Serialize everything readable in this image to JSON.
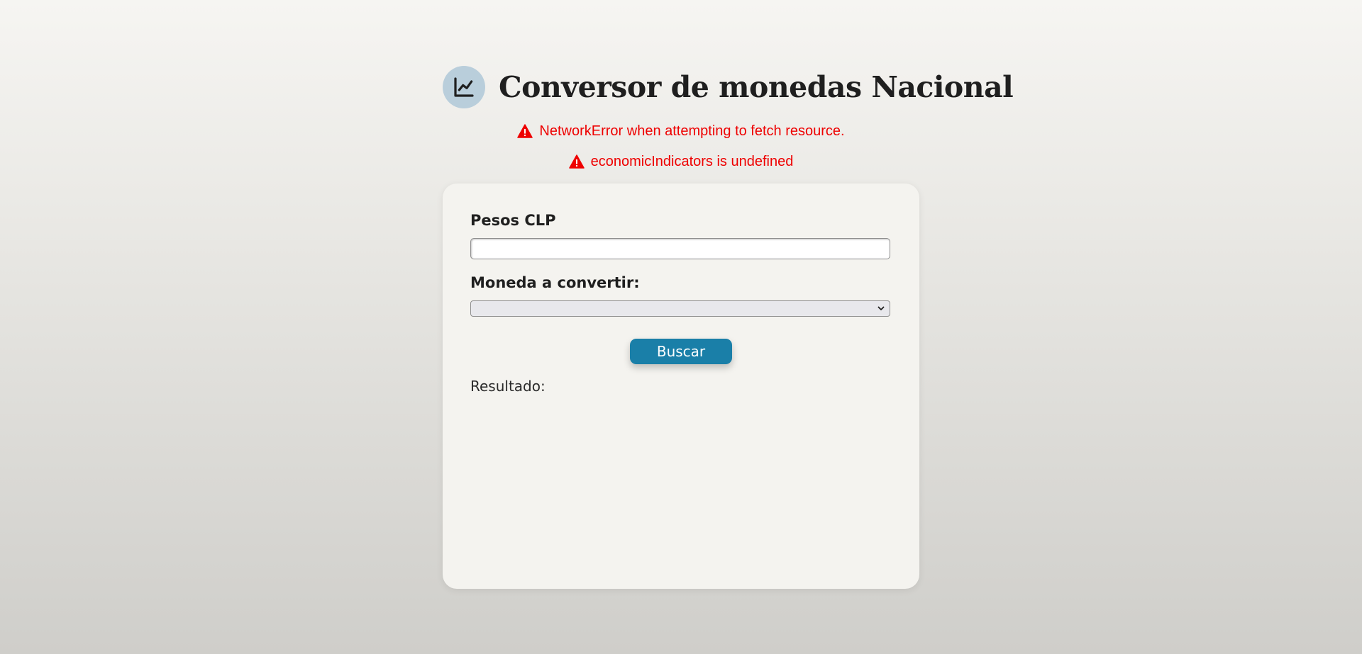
{
  "header": {
    "title": "Conversor de monedas Nacional",
    "logo_icon": "chart-line-icon",
    "logo_bg_color": "#b9cedb"
  },
  "errors": [
    {
      "icon": "warning-triangle-icon",
      "message": "NetworkError when attempting to fetch resource."
    },
    {
      "icon": "warning-triangle-icon",
      "message": "economicIndicators is undefined"
    }
  ],
  "colors": {
    "error": "#ee0000",
    "accent": "#1a7fa8",
    "card_bg": "#f4f3ef"
  },
  "form": {
    "pesos_label": "Pesos CLP",
    "pesos_value": "",
    "pesos_placeholder": "",
    "currency_label": "Moneda a convertir:",
    "currency_selected": "",
    "currency_icon": "chevron-down-icon",
    "search_button": "Buscar",
    "result_label": "Resultado:",
    "result_value": ""
  }
}
